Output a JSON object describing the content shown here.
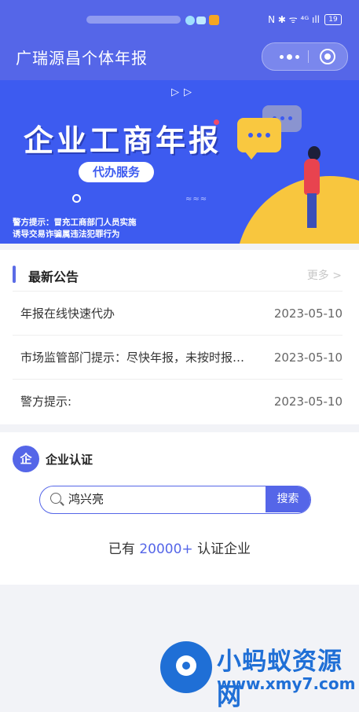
{
  "status_bar": {
    "icons": "N ✱ ᯤ ⁴ᴳ ıll",
    "battery": "19"
  },
  "navbar": {
    "title": "广瑞源昌个体年报"
  },
  "banner": {
    "heading": "企业工商年报",
    "tag": "代办服务",
    "warning_line1": "警方提示：冒充工商部门人员实施",
    "warning_line2": "诱导交易诈骗属违法犯罪行为"
  },
  "notice": {
    "title": "最新公告",
    "more": "更多 >",
    "items": [
      {
        "title": "年报在线快速代办",
        "date": "2023-05-10"
      },
      {
        "title": "市场监管部门提示：尽快年报，未按时报送将被列入经营异常名录",
        "date": "2023-05-10"
      },
      {
        "title": "警方提示:",
        "date": "2023-05-10"
      }
    ]
  },
  "enterprise": {
    "badge": "企",
    "title": "企业认证",
    "search_value": "鸿兴亮",
    "search_button": "搜索",
    "stat_prefix": "已有",
    "stat_number": "20000+",
    "stat_suffix": "认证企业"
  },
  "watermark": {
    "name": "小蚂蚁资源网",
    "url": "www.xmy7.com"
  },
  "colors": {
    "primary": "#5566e8",
    "banner": "#3d5bf0",
    "accent_yellow": "#f8c63e"
  }
}
